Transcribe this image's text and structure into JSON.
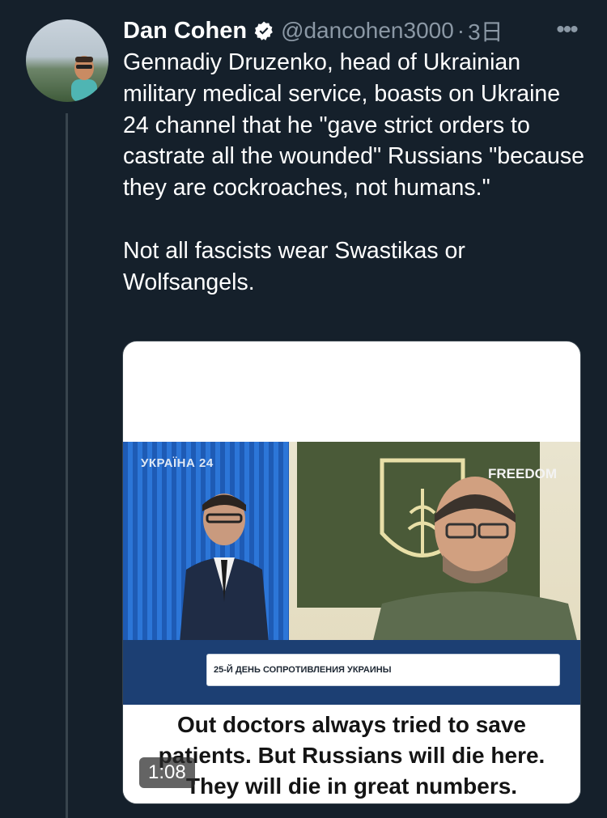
{
  "tweet": {
    "author_name": "Dan Cohen",
    "handle": "@dancohen3000",
    "separator": "·",
    "time": "3日",
    "more_label": "•••",
    "text_paragraph_1": "Gennadiy Druzenko, head of Ukrainian military medical service, boasts on Ukraine 24 channel that he \"gave strict orders to castrate all the wounded\" Russians \"because they are cockroaches, not humans.\"",
    "text_paragraph_2": "Not all fascists wear Swastikas or Wolfsangels."
  },
  "video": {
    "channel_logo": "УКРАЇНА 24",
    "guest_logo": "FREEDOM",
    "lower_third": "25-Й ДЕНЬ СОПРОТИВЛЕНИЯ УКРАИНЫ",
    "caption_line_1": "Out doctors always tried to save",
    "caption_line_2": "patients. But Russians will die here.",
    "caption_line_3": "They will die in great numbers.",
    "duration": "1:08"
  },
  "colors": {
    "background": "#15202b",
    "secondary_text": "#8b98a5",
    "verified": "#ffffff"
  },
  "icons": {
    "verified": "verified-badge-icon",
    "more": "more-options-icon"
  }
}
